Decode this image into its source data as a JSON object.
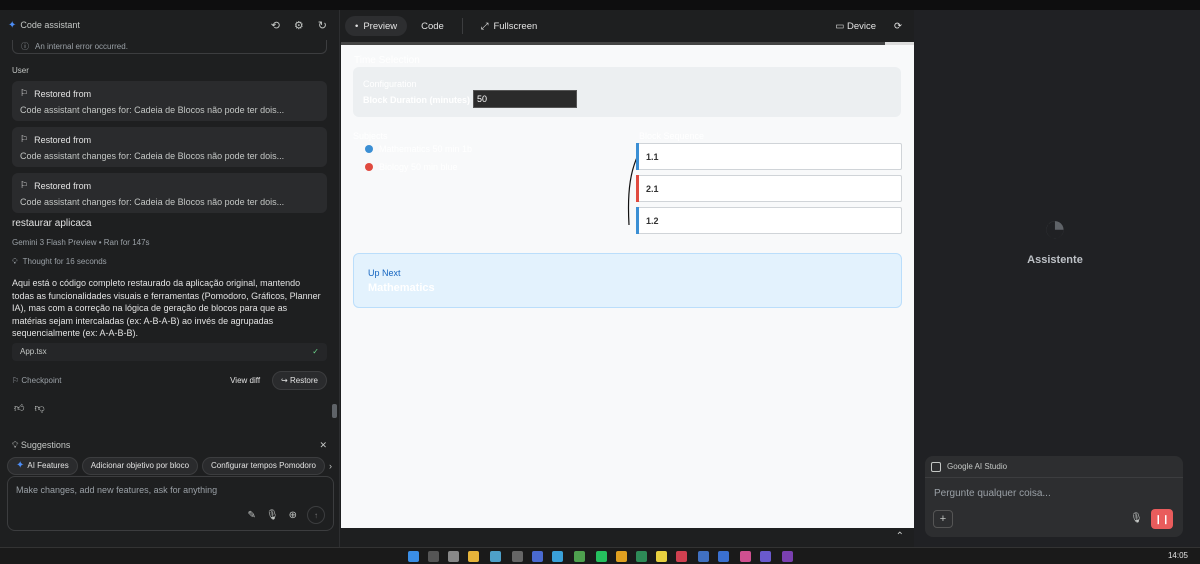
{
  "left": {
    "title": "Code assistant",
    "error_text": "An internal error occurred.",
    "user_label": "User",
    "restored": [
      {
        "title": "Restored from",
        "text": "Code assistant changes for: Cadeia de Blocos não pode ter dois..."
      },
      {
        "title": "Restored from",
        "text": "Code assistant changes for: Cadeia de Blocos não pode ter dois..."
      },
      {
        "title": "Restored from",
        "text": "Code assistant changes for: Cadeia de Blocos não pode ter dois..."
      }
    ],
    "user_message": "restaurar aplicaca",
    "model": "Gemini 3 Flash Preview",
    "run_time": "Ran for 147s",
    "thought": "Thought for 16 seconds",
    "response": "Aqui está o código completo restaurado da aplicação original, mantendo todas as funcionalidades visuais e ferramentas (Pomodoro, Gráficos, Planner IA), mas com a correção na lógica de geração de blocos para que as matérias sejam intercaladas (ex: A-B-A-B) ao invés de agrupadas sequencialmente (ex: A-A-B-B).",
    "file": "App.tsx",
    "checkpoint": "Checkpoint",
    "view_diff": "View diff",
    "restore": "Restore",
    "suggestions_title": "Suggestions",
    "chips": [
      "AI Features",
      "Adicionar objetivo por bloco",
      "Configurar tempos Pomodoro"
    ],
    "input_placeholder": "Make changes, add new features, ask for anything"
  },
  "preview_tabs": {
    "preview": "Preview",
    "code": "Code",
    "fullscreen": "Fullscreen",
    "device": "Device"
  },
  "preview": {
    "section_title": "Time Selection",
    "config_label": "Configuration",
    "block_duration_label": "Block Duration (minutes)",
    "block_duration_value": "50",
    "subjects_label": "Subjects",
    "subjects": [
      {
        "name": "Mathematics 50 min 1b",
        "color": "#3b8fd4"
      },
      {
        "name": "Biology 50 min blue",
        "color": "#e04a3f"
      }
    ],
    "blocks_label": "Block Sequence",
    "blocks": [
      {
        "label": "1.1",
        "color": "#3b8fd4"
      },
      {
        "label": "2.1",
        "color": "#e04a3f"
      },
      {
        "label": "1.2",
        "color": "#3b8fd4"
      }
    ],
    "up_next_label": "Up Next",
    "up_next_value": "Mathematics",
    "progress": 0.95
  },
  "right": {
    "assistant_name": "Assistente",
    "app_name": "Google AI Studio",
    "ask_placeholder": "Pergunte qualquer coisa..."
  },
  "taskbar": {
    "time": "14:05"
  }
}
